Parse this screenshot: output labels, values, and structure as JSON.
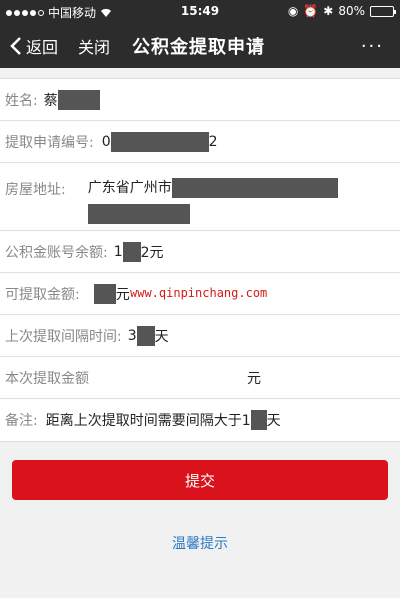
{
  "status_bar": {
    "carrier": "中国移动",
    "time": "15:49",
    "battery": "80%",
    "battery_level": 0.8
  },
  "nav": {
    "back_label": "返回",
    "close_label": "关闭",
    "title": "公积金提取申请",
    "more_label": "···"
  },
  "form": {
    "name": {
      "label": "姓名:",
      "value": "蔡"
    },
    "application_no": {
      "label": "提取申请编号:",
      "value_prefix": "0",
      "value_suffix": "2"
    },
    "address": {
      "label": "房屋地址:",
      "value": "广东省广州市"
    },
    "balance": {
      "label": "公积金账号余额:",
      "value_prefix": "1",
      "value_suffix": "2元"
    },
    "withdrawable": {
      "label": "可提取金额:",
      "value_suffix": "元",
      "watermark": "www.qinpinchang.com"
    },
    "last_interval": {
      "label": "上次提取间隔时间:",
      "value_prefix": "3",
      "value_suffix": "天"
    },
    "this_amount": {
      "label": "本次提取金额",
      "value_suffix": "元"
    },
    "remark": {
      "label": "备注:",
      "value_prefix": "距离上次提取时间需要间隔大于1",
      "value_suffix": "天"
    }
  },
  "submit_label": "提交",
  "tips_label": "温馨提示",
  "colors": {
    "bar": "#2c2c2c",
    "submit": "#d9121b",
    "link": "#2d78c7",
    "watermark": "#d61a1a"
  }
}
